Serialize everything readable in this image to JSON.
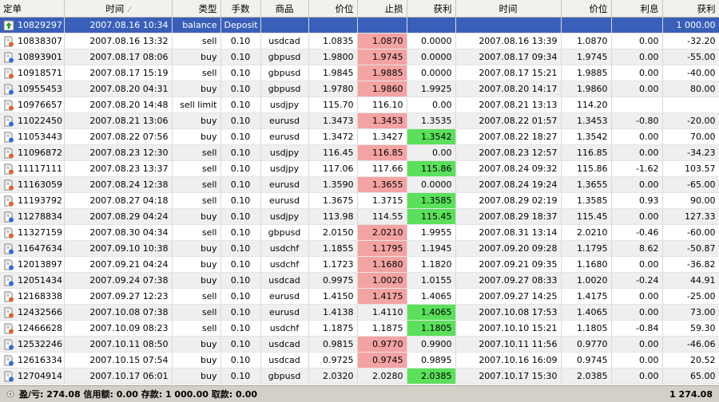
{
  "columns": [
    "定单",
    "时间",
    "类型",
    "手数",
    "商品",
    "价位",
    "止损",
    "获利",
    "时间",
    "价位",
    "利息",
    "获利"
  ],
  "icons": {
    "balance_row": "deposit-arrow-icon",
    "trade_row": "order-document-icon",
    "footer": "status-circle-icon"
  },
  "colors": {
    "selected_row": "#3a5fb8",
    "stop_loss_hit": "#f4a3a3",
    "take_profit_hit": "#5be05b",
    "header_bg": "#f2f1ec",
    "footer_bg": "#d4d0c8"
  },
  "rows": [
    {
      "ticket": "10829297",
      "open_time": "2007.08.16 10:34",
      "type": "balance",
      "lots": "Deposit",
      "symbol": "",
      "open_price": "",
      "sl": "",
      "tp": "",
      "close_time": "",
      "close_price": "",
      "swap": "",
      "profit": "1 000.00",
      "hit": "",
      "row_kind": "balance"
    },
    {
      "ticket": "10838307",
      "open_time": "2007.08.16 13:32",
      "type": "sell",
      "lots": "0.10",
      "symbol": "usdcad",
      "open_price": "1.0835",
      "sl": "1.0870",
      "tp": "0.0000",
      "close_time": "2007.08.16 13:39",
      "close_price": "1.0870",
      "swap": "0.00",
      "profit": "-32.20",
      "hit": "sl"
    },
    {
      "ticket": "10893901",
      "open_time": "2007.08.17 08:06",
      "type": "buy",
      "lots": "0.10",
      "symbol": "gbpusd",
      "open_price": "1.9800",
      "sl": "1.9745",
      "tp": "0.0000",
      "close_time": "2007.08.17 09:34",
      "close_price": "1.9745",
      "swap": "0.00",
      "profit": "-55.00",
      "hit": "sl"
    },
    {
      "ticket": "10918571",
      "open_time": "2007.08.17 15:19",
      "type": "sell",
      "lots": "0.10",
      "symbol": "gbpusd",
      "open_price": "1.9845",
      "sl": "1.9885",
      "tp": "0.0000",
      "close_time": "2007.08.17 15:21",
      "close_price": "1.9885",
      "swap": "0.00",
      "profit": "-40.00",
      "hit": "sl"
    },
    {
      "ticket": "10955453",
      "open_time": "2007.08.20 04:31",
      "type": "buy",
      "lots": "0.10",
      "symbol": "gbpusd",
      "open_price": "1.9780",
      "sl": "1.9860",
      "tp": "1.9925",
      "close_time": "2007.08.20 14:17",
      "close_price": "1.9860",
      "swap": "0.00",
      "profit": "80.00",
      "hit": "sl"
    },
    {
      "ticket": "10976657",
      "open_time": "2007.08.20 14:48",
      "type": "sell limit",
      "lots": "0.10",
      "symbol": "usdjpy",
      "open_price": "115.70",
      "sl": "116.10",
      "tp": "0.00",
      "close_time": "2007.08.21 13:13",
      "close_price": "114.20",
      "swap": "",
      "profit": "",
      "hit": ""
    },
    {
      "ticket": "11022450",
      "open_time": "2007.08.21 13:06",
      "type": "buy",
      "lots": "0.10",
      "symbol": "eurusd",
      "open_price": "1.3473",
      "sl": "1.3453",
      "tp": "1.3535",
      "close_time": "2007.08.22 01:57",
      "close_price": "1.3453",
      "swap": "-0.80",
      "profit": "-20.00",
      "hit": "sl"
    },
    {
      "ticket": "11053443",
      "open_time": "2007.08.22 07:56",
      "type": "buy",
      "lots": "0.10",
      "symbol": "eurusd",
      "open_price": "1.3472",
      "sl": "1.3427",
      "tp": "1.3542",
      "close_time": "2007.08.22 18:27",
      "close_price": "1.3542",
      "swap": "0.00",
      "profit": "70.00",
      "hit": "tp"
    },
    {
      "ticket": "11096872",
      "open_time": "2007.08.23 12:30",
      "type": "sell",
      "lots": "0.10",
      "symbol": "usdjpy",
      "open_price": "116.45",
      "sl": "116.85",
      "tp": "0.00",
      "close_time": "2007.08.23 12:57",
      "close_price": "116.85",
      "swap": "0.00",
      "profit": "-34.23",
      "hit": "sl"
    },
    {
      "ticket": "11117111",
      "open_time": "2007.08.23 13:37",
      "type": "sell",
      "lots": "0.10",
      "symbol": "usdjpy",
      "open_price": "117.06",
      "sl": "117.66",
      "tp": "115.86",
      "close_time": "2007.08.24 09:32",
      "close_price": "115.86",
      "swap": "-1.62",
      "profit": "103.57",
      "hit": "tp"
    },
    {
      "ticket": "11163059",
      "open_time": "2007.08.24 12:38",
      "type": "sell",
      "lots": "0.10",
      "symbol": "eurusd",
      "open_price": "1.3590",
      "sl": "1.3655",
      "tp": "0.0000",
      "close_time": "2007.08.24 19:24",
      "close_price": "1.3655",
      "swap": "0.00",
      "profit": "-65.00",
      "hit": "sl"
    },
    {
      "ticket": "11193792",
      "open_time": "2007.08.27 04:18",
      "type": "sell",
      "lots": "0.10",
      "symbol": "eurusd",
      "open_price": "1.3675",
      "sl": "1.3715",
      "tp": "1.3585",
      "close_time": "2007.08.29 02:19",
      "close_price": "1.3585",
      "swap": "0.93",
      "profit": "90.00",
      "hit": "tp"
    },
    {
      "ticket": "11278834",
      "open_time": "2007.08.29 04:24",
      "type": "buy",
      "lots": "0.10",
      "symbol": "usdjpy",
      "open_price": "113.98",
      "sl": "114.55",
      "tp": "115.45",
      "close_time": "2007.08.29 18:37",
      "close_price": "115.45",
      "swap": "0.00",
      "profit": "127.33",
      "hit": "tp"
    },
    {
      "ticket": "11327159",
      "open_time": "2007.08.30 04:34",
      "type": "sell",
      "lots": "0.10",
      "symbol": "gbpusd",
      "open_price": "2.0150",
      "sl": "2.0210",
      "tp": "1.9955",
      "close_time": "2007.08.31 13:14",
      "close_price": "2.0210",
      "swap": "-0.46",
      "profit": "-60.00",
      "hit": "sl"
    },
    {
      "ticket": "11647634",
      "open_time": "2007.09.10 10:38",
      "type": "buy",
      "lots": "0.10",
      "symbol": "usdchf",
      "open_price": "1.1855",
      "sl": "1.1795",
      "tp": "1.1945",
      "close_time": "2007.09.20 09:28",
      "close_price": "1.1795",
      "swap": "8.62",
      "profit": "-50.87",
      "hit": "sl"
    },
    {
      "ticket": "12013897",
      "open_time": "2007.09.21 04:24",
      "type": "buy",
      "lots": "0.10",
      "symbol": "usdchf",
      "open_price": "1.1723",
      "sl": "1.1680",
      "tp": "1.1820",
      "close_time": "2007.09.21 09:35",
      "close_price": "1.1680",
      "swap": "0.00",
      "profit": "-36.82",
      "hit": "sl"
    },
    {
      "ticket": "12051434",
      "open_time": "2007.09.24 07:38",
      "type": "buy",
      "lots": "0.10",
      "symbol": "usdcad",
      "open_price": "0.9975",
      "sl": "1.0020",
      "tp": "1.0155",
      "close_time": "2007.09.27 08:33",
      "close_price": "1.0020",
      "swap": "-0.24",
      "profit": "44.91",
      "hit": "sl"
    },
    {
      "ticket": "12168338",
      "open_time": "2007.09.27 12:23",
      "type": "sell",
      "lots": "0.10",
      "symbol": "eurusd",
      "open_price": "1.4150",
      "sl": "1.4175",
      "tp": "1.4065",
      "close_time": "2007.09.27 14:25",
      "close_price": "1.4175",
      "swap": "0.00",
      "profit": "-25.00",
      "hit": "sl"
    },
    {
      "ticket": "12432566",
      "open_time": "2007.10.08 07:38",
      "type": "sell",
      "lots": "0.10",
      "symbol": "eurusd",
      "open_price": "1.4138",
      "sl": "1.4110",
      "tp": "1.4065",
      "close_time": "2007.10.08 17:53",
      "close_price": "1.4065",
      "swap": "0.00",
      "profit": "73.00",
      "hit": "tp"
    },
    {
      "ticket": "12466628",
      "open_time": "2007.10.09 08:23",
      "type": "sell",
      "lots": "0.10",
      "symbol": "usdchf",
      "open_price": "1.1875",
      "sl": "1.1875",
      "tp": "1.1805",
      "close_time": "2007.10.10 15:21",
      "close_price": "1.1805",
      "swap": "-0.84",
      "profit": "59.30",
      "hit": "tp"
    },
    {
      "ticket": "12532246",
      "open_time": "2007.10.11 08:50",
      "type": "buy",
      "lots": "0.10",
      "symbol": "usdcad",
      "open_price": "0.9815",
      "sl": "0.9770",
      "tp": "0.9900",
      "close_time": "2007.10.11 11:56",
      "close_price": "0.9770",
      "swap": "0.00",
      "profit": "-46.06",
      "hit": "sl"
    },
    {
      "ticket": "12616334",
      "open_time": "2007.10.15 07:54",
      "type": "buy",
      "lots": "0.10",
      "symbol": "usdcad",
      "open_price": "0.9725",
      "sl": "0.9745",
      "tp": "0.9895",
      "close_time": "2007.10.16 16:09",
      "close_price": "0.9745",
      "swap": "0.00",
      "profit": "20.52",
      "hit": "sl"
    },
    {
      "ticket": "12704914",
      "open_time": "2007.10.17 06:01",
      "type": "buy",
      "lots": "0.10",
      "symbol": "gbpusd",
      "open_price": "2.0320",
      "sl": "2.0280",
      "tp": "2.0385",
      "close_time": "2007.10.17 15:30",
      "close_price": "2.0385",
      "swap": "0.00",
      "profit": "65.00",
      "hit": "tp"
    }
  ],
  "footer": {
    "summary": "盈/亏: 274.08  信用额: 0.00  存款: 1 000.00  取款: 0.00",
    "total": "1 274.08"
  }
}
